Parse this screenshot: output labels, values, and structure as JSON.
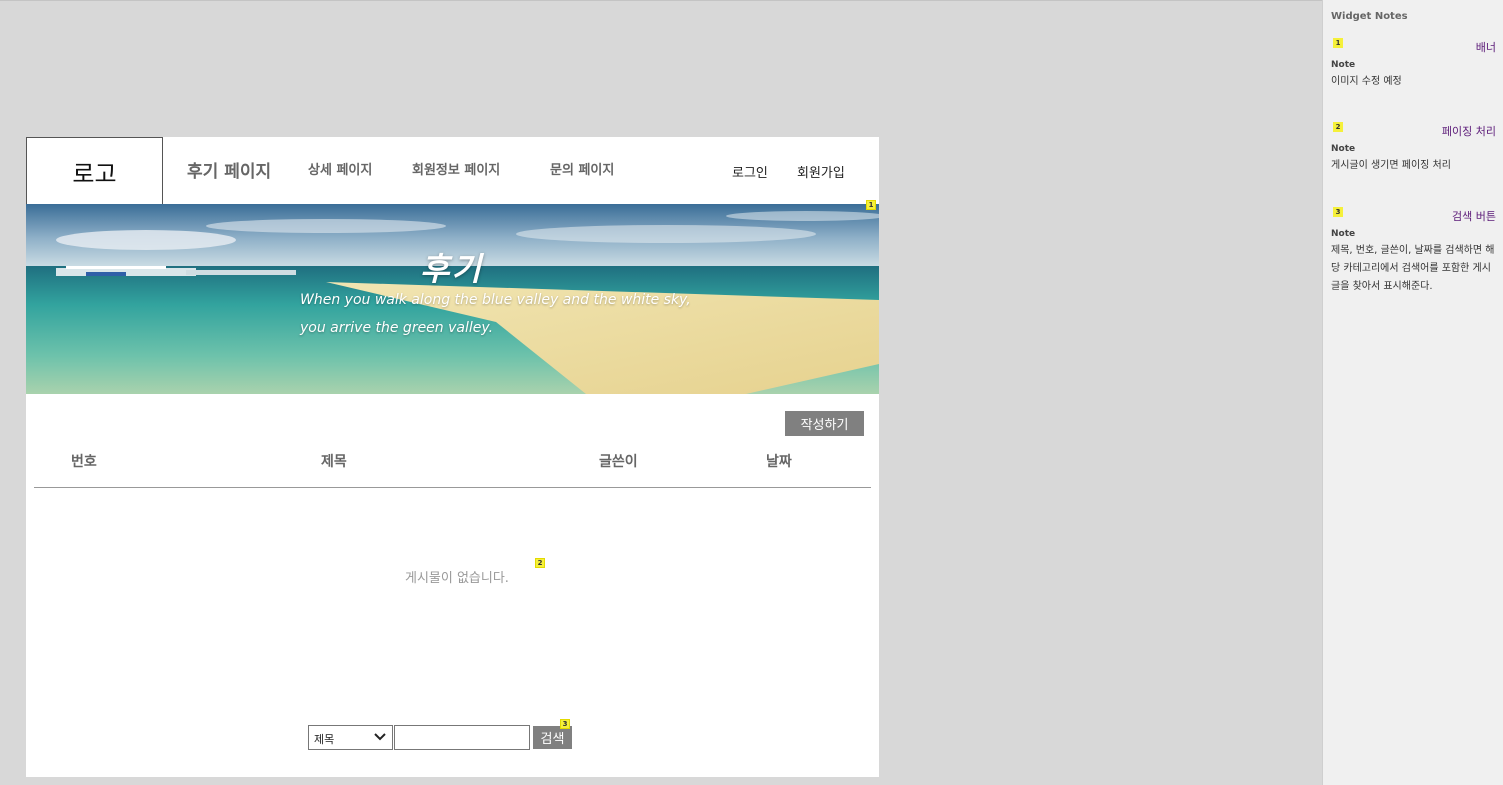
{
  "header": {
    "logo": "로고",
    "nav": [
      "후기 페이지",
      "상세 페이지",
      "회원정보 페이지",
      "문의 페이지"
    ],
    "login": "로그인",
    "join": "회원가입"
  },
  "banner": {
    "title": "후기",
    "line1": "When you walk along the blue valley and the white sky,",
    "line2": "you arrive the green valley."
  },
  "board": {
    "write_button": "작성하기",
    "columns": [
      "번호",
      "제목",
      "글쓴이",
      "날짜"
    ],
    "empty_message": "게시물이 없습니다."
  },
  "search": {
    "selected_option": "제목",
    "input_value": "",
    "button": "검색"
  },
  "markers": [
    "1",
    "2",
    "3"
  ],
  "notes_panel": {
    "title": "Widget Notes",
    "items": [
      {
        "num": "1",
        "name": "배너",
        "label": "Note",
        "text": "이미지 수정 예정"
      },
      {
        "num": "2",
        "name": "페이징 처리",
        "label": "Note",
        "text": "게시글이 생기면 페이징 처리"
      },
      {
        "num": "3",
        "name": "검색 버튼",
        "label": "Note",
        "text": "제목, 번호, 글쓴이, 날짜를 검색하면 해당 카테고리에서 검색어를 포함한 게시글을 찾아서 표시해준다."
      }
    ]
  },
  "colors": {
    "button_gray": "#808080",
    "marker_yellow": "#f5f03a",
    "note_name_purple": "#5b1a78"
  }
}
